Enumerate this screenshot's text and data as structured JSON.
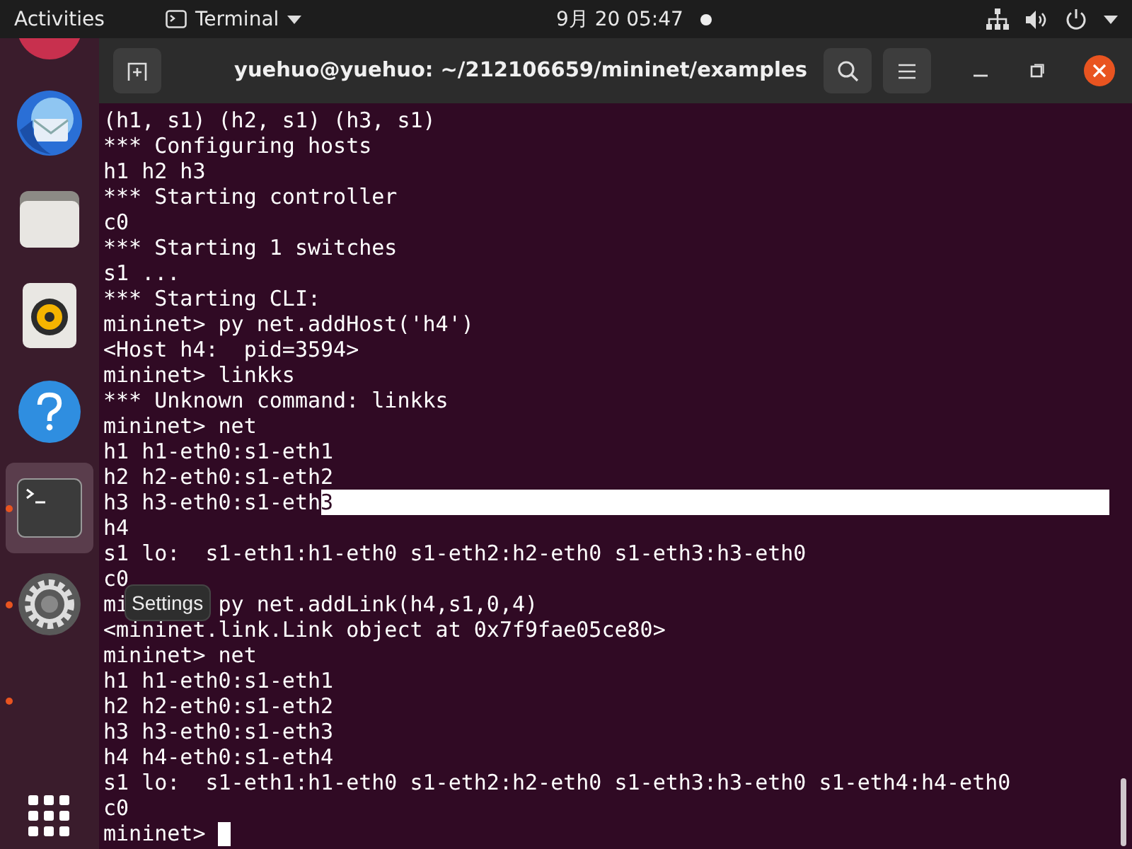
{
  "top_bar": {
    "activities": "Activities",
    "app_menu": "Terminal",
    "clock": "9月 20  05:47"
  },
  "dock": {
    "items": [
      {
        "kind": "partial",
        "selected": false,
        "running": false
      },
      {
        "kind": "mail",
        "selected": false,
        "running": false
      },
      {
        "kind": "files",
        "selected": false,
        "running": false
      },
      {
        "kind": "music",
        "selected": false,
        "running": false
      },
      {
        "kind": "help",
        "selected": false,
        "running": false
      },
      {
        "kind": "terminal",
        "selected": true,
        "running": true
      },
      {
        "kind": "settings",
        "selected": false,
        "running": true
      },
      {
        "kind": "empty",
        "selected": false,
        "running": true
      }
    ],
    "tooltip": "Settings"
  },
  "window": {
    "title": "yuehuo@yuehuo: ~/212106659/mininet/examples"
  },
  "terminal": {
    "lines": [
      {
        "text": "(h1, s1) (h2, s1) (h3, s1)"
      },
      {
        "text": "*** Configuring hosts"
      },
      {
        "text": "h1 h2 h3"
      },
      {
        "text": "*** Starting controller"
      },
      {
        "text": "c0"
      },
      {
        "text": "*** Starting 1 switches"
      },
      {
        "text": "s1 ..."
      },
      {
        "text": "*** Starting CLI:"
      },
      {
        "text": "mininet> py net.addHost('h4')"
      },
      {
        "text": "<Host h4:  pid=3594>"
      },
      {
        "text": "mininet> linkks"
      },
      {
        "text": "*** Unknown command: linkks"
      },
      {
        "text": "mininet> net"
      },
      {
        "text": "h1 h1-eth0:s1-eth1"
      },
      {
        "text": "h2 h2-eth0:s1-eth2"
      },
      {
        "text": "h3 h3-eth0:s1-eth",
        "selection": "3"
      },
      {
        "text": "h4"
      },
      {
        "text": "s1 lo:  s1-eth1:h1-eth0 s1-eth2:h2-eth0 s1-eth3:h3-eth0"
      },
      {
        "text": "c0"
      },
      {
        "parts": [
          "mi",
          "py net.addLink(h4,s1,0,4)"
        ]
      },
      {
        "text": "<mininet.link.Link object at 0x7f9fae05ce80>"
      },
      {
        "text": "mininet> net"
      },
      {
        "text": "h1 h1-eth0:s1-eth1"
      },
      {
        "text": "h2 h2-eth0:s1-eth2"
      },
      {
        "text": "h3 h3-eth0:s1-eth3"
      },
      {
        "text": "h4 h4-eth0:s1-eth4"
      },
      {
        "text": "s1 lo:  s1-eth1:h1-eth0 s1-eth2:h2-eth0 s1-eth3:h3-eth0 s1-eth4:h4-eth0"
      },
      {
        "text": "c0"
      },
      {
        "text": "mininet> ",
        "cursor": true
      }
    ]
  }
}
